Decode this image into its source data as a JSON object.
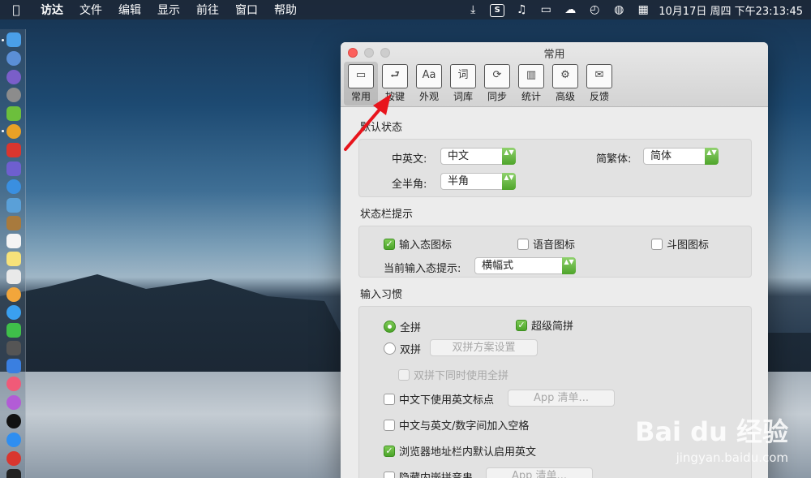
{
  "menubar": {
    "app": "访达",
    "menus": [
      "文件",
      "编辑",
      "显示",
      "前往",
      "窗口",
      "帮助"
    ],
    "clock": "10月17日 周四 下午23:13:45",
    "status_icons": [
      "download-icon",
      "sogou-s-icon",
      "music-note-icon",
      "share-screen-icon",
      "ghost-icon",
      "compass-icon",
      "globe-icon",
      "calendar-icon"
    ],
    "sogou_glyph": "S"
  },
  "window": {
    "title": "常用",
    "tabs": [
      {
        "label": "常用",
        "icon": "general-icon",
        "glyph": "▭",
        "selected": true
      },
      {
        "label": "按键",
        "icon": "keys-icon",
        "glyph": "⮐",
        "selected": false
      },
      {
        "label": "外观",
        "icon": "appearance-icon",
        "glyph": "Aa",
        "selected": false
      },
      {
        "label": "词库",
        "icon": "dictionary-icon",
        "glyph": "词",
        "selected": false
      },
      {
        "label": "同步",
        "icon": "sync-icon",
        "glyph": "⟳",
        "selected": false
      },
      {
        "label": "统计",
        "icon": "stats-icon",
        "glyph": "▥",
        "selected": false
      },
      {
        "label": "高级",
        "icon": "advanced-gear-icon",
        "glyph": "⚙",
        "selected": false
      },
      {
        "label": "反馈",
        "icon": "feedback-mail-icon",
        "glyph": "✉",
        "selected": false
      }
    ]
  },
  "default_state": {
    "title": "默认状态",
    "zh_en_label": "中英文:",
    "zh_en_value": "中文",
    "trad_simp_label": "简繁体:",
    "trad_simp_value": "简体",
    "width_label": "全半角:",
    "width_value": "半角"
  },
  "statusbar_hint": {
    "title": "状态栏提示",
    "input_state_icon": "输入态图标",
    "voice_icon": "语音图标",
    "doutu_icon": "斗图图标",
    "current_hint_label": "当前输入态提示:",
    "current_hint_value": "横幅式"
  },
  "input_habits": {
    "title": "输入习惯",
    "quanpin": "全拼",
    "super_jianpin": "超级简拼",
    "shuangpin": "双拼",
    "shuangpin_settings": "双拼方案设置",
    "shuangpin_with_quanpin": "双拼下同时使用全拼",
    "en_punct_in_zh": "中文下使用英文标点",
    "app_list_1": "App 清单...",
    "space_between": "中文与英文/数字间加入空格",
    "browser_en_default": "浏览器地址栏内默认启用英文",
    "hide_inline": "隐藏内嵌拼音串",
    "app_list_2": "App 清单..."
  },
  "watermark": {
    "main": "Bai du 经验",
    "sub": "jingyan.baidu.com"
  },
  "check_mark": "✓",
  "stepper_glyph": "▲▼"
}
